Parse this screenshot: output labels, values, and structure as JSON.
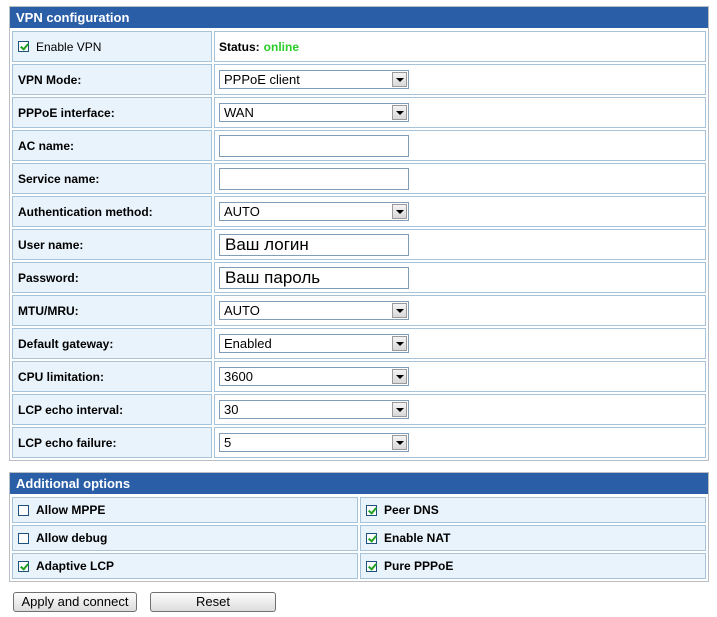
{
  "vpn": {
    "title": "VPN configuration",
    "enable_label": "Enable VPN",
    "enable_checked": true,
    "status_label": "Status:",
    "status_value": "online",
    "rows": {
      "mode": {
        "label": "VPN Mode:",
        "value": "PPPoE client"
      },
      "pppoe_interface": {
        "label": "PPPoE interface:",
        "value": "WAN"
      },
      "ac_name": {
        "label": "AC name:",
        "value": ""
      },
      "service_name": {
        "label": "Service name:",
        "value": ""
      },
      "auth_method": {
        "label": "Authentication method:",
        "value": "AUTO"
      },
      "user_name": {
        "label": "User name:",
        "value": "Ваш логин"
      },
      "password": {
        "label": "Password:",
        "value": "Ваш пароль"
      },
      "mtu": {
        "label": "MTU/MRU:",
        "value": "AUTO"
      },
      "default_gateway": {
        "label": "Default gateway:",
        "value": "Enabled"
      },
      "cpu_limitation": {
        "label": "CPU limitation:",
        "value": "3600"
      },
      "lcp_echo_interval": {
        "label": "LCP echo interval:",
        "value": "30"
      },
      "lcp_echo_failure": {
        "label": "LCP echo failure:",
        "value": "5"
      }
    }
  },
  "additional": {
    "title": "Additional options",
    "options": {
      "allow_mppe": {
        "label": "Allow MPPE",
        "checked": false
      },
      "peer_dns": {
        "label": "Peer DNS",
        "checked": true
      },
      "allow_debug": {
        "label": "Allow debug",
        "checked": false
      },
      "enable_nat": {
        "label": "Enable NAT",
        "checked": true
      },
      "adaptive_lcp": {
        "label": "Adaptive LCP",
        "checked": true
      },
      "pure_pppoe": {
        "label": "Pure PPPoE",
        "checked": true
      }
    }
  },
  "buttons": {
    "apply": "Apply and connect",
    "reset": "Reset"
  },
  "colors": {
    "header_bg": "#2a5fa8",
    "label_bg": "#e9f3fb",
    "status_online": "#29cc29"
  }
}
